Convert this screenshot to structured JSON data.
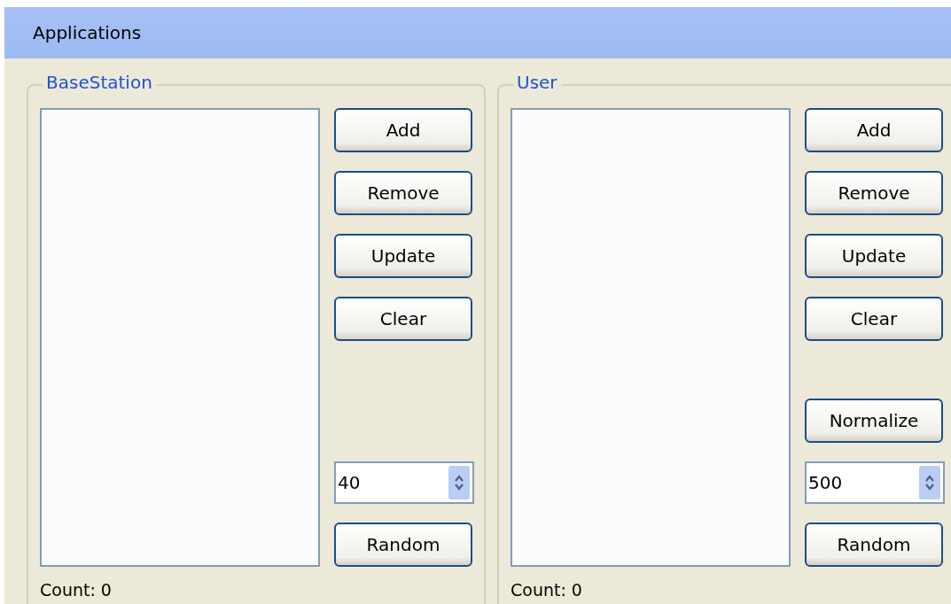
{
  "header": {
    "title": "Applications"
  },
  "groups": [
    {
      "title": "BaseStation",
      "top_buttons": [
        "Add",
        "Remove",
        "Update",
        "Clear"
      ],
      "bottom_controls": [
        {
          "kind": "spinner",
          "value": "40"
        },
        {
          "kind": "button",
          "label": "Random"
        }
      ],
      "count": "Count: 0"
    },
    {
      "title": "User",
      "top_buttons": [
        "Add",
        "Remove",
        "Update",
        "Clear"
      ],
      "bottom_controls": [
        {
          "kind": "button",
          "label": "Normalize"
        },
        {
          "kind": "spinner",
          "value": "500"
        },
        {
          "kind": "button",
          "label": "Random"
        }
      ],
      "count": "Count: 0"
    }
  ]
}
